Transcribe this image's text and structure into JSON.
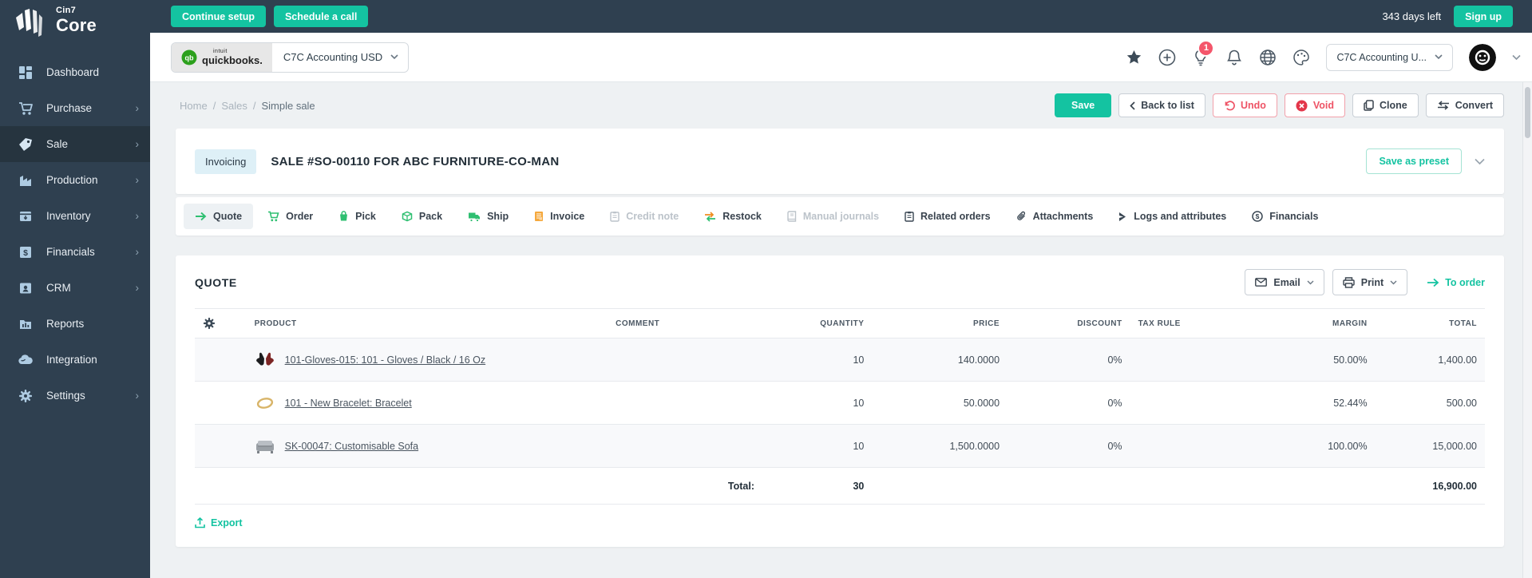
{
  "topbar": {
    "continue_setup": "Continue setup",
    "schedule_call": "Schedule a call",
    "days_left": "343 days left",
    "sign_up": "Sign up"
  },
  "brand": {
    "name_small": "Cin7",
    "name_big": "Core"
  },
  "sidebar": {
    "items": [
      {
        "label": "Dashboard",
        "icon": "dashboard-grid-icon",
        "active": false,
        "chevron": false
      },
      {
        "label": "Purchase",
        "icon": "cart-icon",
        "active": false,
        "chevron": true
      },
      {
        "label": "Sale",
        "icon": "tag-icon",
        "active": true,
        "chevron": true
      },
      {
        "label": "Production",
        "icon": "factory-icon",
        "active": false,
        "chevron": true
      },
      {
        "label": "Inventory",
        "icon": "box-icon",
        "active": false,
        "chevron": true
      },
      {
        "label": "Financials",
        "icon": "dollar-square-icon",
        "active": false,
        "chevron": true
      },
      {
        "label": "CRM",
        "icon": "contact-card-icon",
        "active": false,
        "chevron": true
      },
      {
        "label": "Reports",
        "icon": "folder-chart-icon",
        "active": false,
        "chevron": false
      },
      {
        "label": "Integration",
        "icon": "cloud-icon",
        "active": false,
        "chevron": false
      },
      {
        "label": "Settings",
        "icon": "gear-icon",
        "active": false,
        "chevron": true
      }
    ]
  },
  "header": {
    "integration_brand_top": "intuit",
    "integration_brand": "quickbooks.",
    "integration_account": "C7C Accounting USD",
    "notification_count": "1",
    "account_selector": "C7C Accounting U...",
    "icons": [
      "star-icon",
      "plus-circle-icon",
      "lightbulb-icon",
      "bell-icon",
      "globe-icon",
      "palette-icon"
    ]
  },
  "breadcrumb": {
    "home": "Home",
    "section": "Sales",
    "current": "Simple sale",
    "sep": "/"
  },
  "actions": {
    "save": "Save",
    "back": "Back to list",
    "undo": "Undo",
    "void": "Void",
    "clone": "Clone",
    "convert": "Convert"
  },
  "document": {
    "status_badge": "Invoicing",
    "title": "SALE #SO-00110 FOR ABC FURNITURE-CO-MAN",
    "save_preset": "Save as preset"
  },
  "tabs": [
    {
      "label": "Quote",
      "icon": "arrow-right-icon",
      "state": "active"
    },
    {
      "label": "Order",
      "icon": "cart-icon",
      "state": "enabled"
    },
    {
      "label": "Pick",
      "icon": "pick-bag-icon",
      "state": "enabled"
    },
    {
      "label": "Pack",
      "icon": "package-icon",
      "state": "enabled"
    },
    {
      "label": "Ship",
      "icon": "truck-icon",
      "state": "enabled"
    },
    {
      "label": "Invoice",
      "icon": "invoice-doc-icon",
      "state": "enabled"
    },
    {
      "label": "Credit note",
      "icon": "clipboard-icon",
      "state": "disabled"
    },
    {
      "label": "Restock",
      "icon": "swap-arrows-icon",
      "state": "enabled"
    },
    {
      "label": "Manual journals",
      "icon": "journal-book-icon",
      "state": "disabled"
    },
    {
      "label": "Related orders",
      "icon": "clipboard-icon",
      "state": "enabled"
    },
    {
      "label": "Attachments",
      "icon": "paperclip-icon",
      "state": "enabled"
    },
    {
      "label": "Logs and attributes",
      "icon": "chevron-solid-icon",
      "state": "enabled"
    },
    {
      "label": "Financials",
      "icon": "dollar-circle-icon",
      "state": "enabled"
    }
  ],
  "quote": {
    "heading": "QUOTE",
    "email": "Email",
    "print": "Print",
    "to_order": "To order",
    "export": "Export"
  },
  "table": {
    "headers": {
      "product": "PRODUCT",
      "comment": "COMMENT",
      "quantity": "QUANTITY",
      "price": "PRICE",
      "discount": "DISCOUNT",
      "tax_rule": "TAX RULE",
      "margin": "MARGIN",
      "total": "TOTAL"
    },
    "rows": [
      {
        "thumb": "gloves-thumbnail",
        "product": "101-Gloves-015: 101 - Gloves / Black / 16 Oz",
        "comment": "",
        "quantity": "10",
        "price": "140.0000",
        "discount": "0%",
        "tax_rule": "",
        "margin": "50.00%",
        "total": "1,400.00"
      },
      {
        "thumb": "bracelet-thumbnail",
        "product": "101 - New Bracelet: Bracelet",
        "comment": "",
        "quantity": "10",
        "price": "50.0000",
        "discount": "0%",
        "tax_rule": "",
        "margin": "52.44%",
        "total": "500.00"
      },
      {
        "thumb": "sofa-thumbnail",
        "product": "SK-00047: Customisable Sofa",
        "comment": "",
        "quantity": "10",
        "price": "1,500.0000",
        "discount": "0%",
        "tax_rule": "",
        "margin": "100.00%",
        "total": "15,000.00"
      }
    ],
    "total_label": "Total:",
    "total_quantity": "30",
    "total_amount": "16,900.00"
  },
  "colors": {
    "accent": "#14c3a1",
    "danger": "#ee5365",
    "dark": "#2f4050",
    "badge": "#f4566b"
  }
}
